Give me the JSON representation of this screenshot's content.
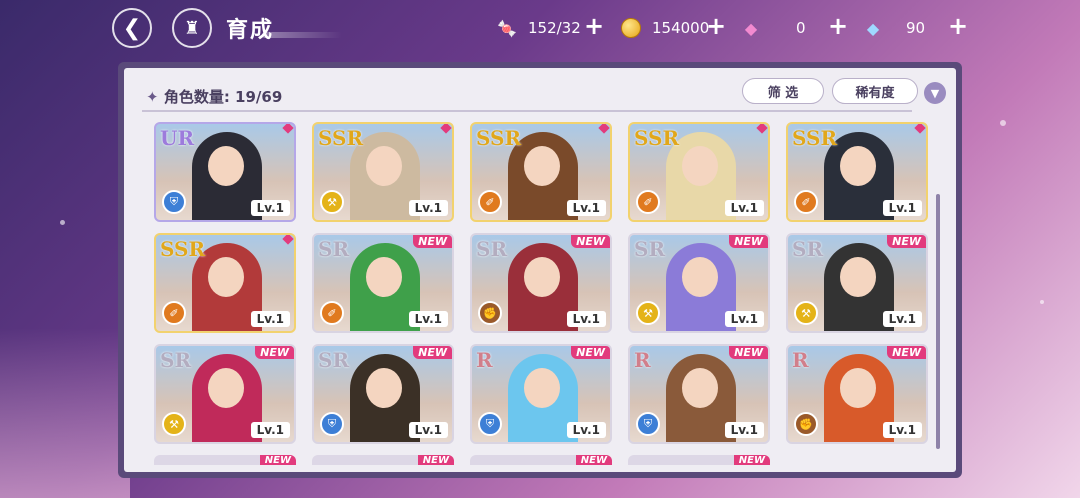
{
  "header": {
    "title": "育成",
    "resources": [
      {
        "name": "candy",
        "icon": "candy-icon",
        "value": "152/32"
      },
      {
        "name": "coin",
        "icon": "coin-icon",
        "value": "154000"
      },
      {
        "name": "pink-gem",
        "icon": "pink-gem-icon",
        "value": "0"
      },
      {
        "name": "blue-gem",
        "icon": "blue-gem-icon",
        "value": "90"
      }
    ]
  },
  "panel": {
    "count_label": "角色数量: 19/69",
    "filter_label": "筛 选",
    "rarity_label": "稀有度"
  },
  "cards": [
    {
      "rarity": "UR",
      "element": "shield",
      "level": "Lv.1",
      "new": false
    },
    {
      "rarity": "SSR",
      "element": "key",
      "level": "Lv.1",
      "new": false
    },
    {
      "rarity": "SSR",
      "element": "book",
      "level": "Lv.1",
      "new": false
    },
    {
      "rarity": "SSR",
      "element": "book",
      "level": "Lv.1",
      "new": false
    },
    {
      "rarity": "SSR",
      "element": "book",
      "level": "Lv.1",
      "new": false
    },
    {
      "rarity": "SSR",
      "element": "book",
      "level": "Lv.1",
      "new": false
    },
    {
      "rarity": "SR",
      "element": "book",
      "level": "Lv.1",
      "new": true
    },
    {
      "rarity": "SR",
      "element": "fist",
      "level": "Lv.1",
      "new": true
    },
    {
      "rarity": "SR",
      "element": "key",
      "level": "Lv.1",
      "new": true
    },
    {
      "rarity": "SR",
      "element": "key",
      "level": "Lv.1",
      "new": true
    },
    {
      "rarity": "SR",
      "element": "key",
      "level": "Lv.1",
      "new": true
    },
    {
      "rarity": "SR",
      "element": "shield",
      "level": "Lv.1",
      "new": true
    },
    {
      "rarity": "R",
      "element": "shield",
      "level": "Lv.1",
      "new": true
    },
    {
      "rarity": "R",
      "element": "shield",
      "level": "Lv.1",
      "new": true
    },
    {
      "rarity": "R",
      "element": "fist",
      "level": "Lv.1",
      "new": true
    }
  ],
  "new_label": "NEW",
  "colors": {
    "ur": "#9d7bdc",
    "ssr": "#e1a71b",
    "sr": "#b3adc0",
    "r": "#d17f8b",
    "new_badge": "#e23b7d",
    "element_shield": "#3d7fd6",
    "element_key": "#e4b318",
    "element_book": "#e07a1f",
    "element_fist": "#9a5a2a"
  }
}
